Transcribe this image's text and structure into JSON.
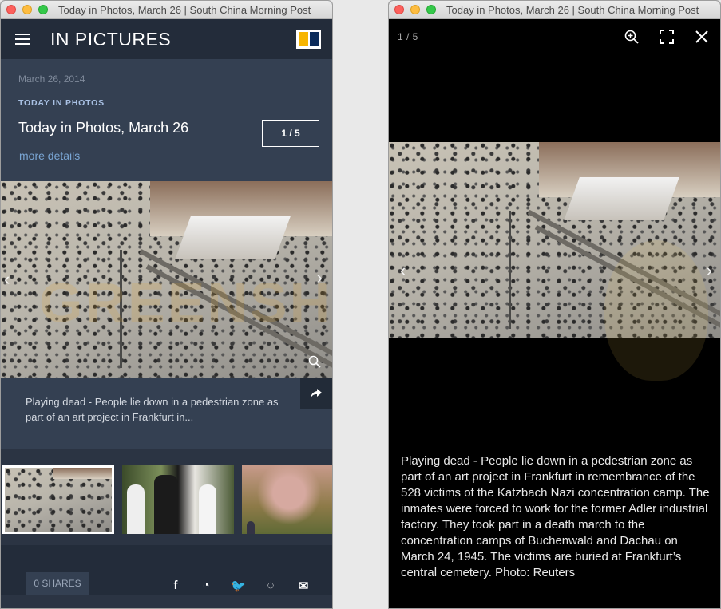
{
  "left_window": {
    "title": "Today in Photos, March 26 | South China Morning Post",
    "header": {
      "section": "IN PICTURES",
      "logo": "scmp-logo",
      "menu_icon": "hamburger-icon"
    },
    "article": {
      "date": "March 26, 2014",
      "kicker": "TODAY IN PHOTOS",
      "headline": "Today in Photos, March 26",
      "counter": "1 / 5",
      "more_label": "more details"
    },
    "photo": {
      "watermark": "GREENSHOT.FYI",
      "next_icon": "chevron-right-icon",
      "prev_icon": "chevron-left-icon",
      "zoom_icon": "search-icon"
    },
    "caption": "Playing dead - People lie down in a pedestrian zone as part of an art project in Frankfurt in...",
    "share_icon": "share-icon",
    "thumbnails": [
      {
        "name": "thumb-frankfurt",
        "selected": true
      },
      {
        "name": "thumb-tai-chi",
        "selected": false
      },
      {
        "name": "thumb-blossom",
        "selected": false
      }
    ],
    "footer": {
      "shares_label": "0 SHARES",
      "social": [
        {
          "icon": "facebook-icon",
          "glyph": "f"
        },
        {
          "icon": "messenger-icon",
          "glyph": "◔"
        },
        {
          "icon": "twitter-icon",
          "glyph": "🐦"
        },
        {
          "icon": "whatsapp-icon",
          "glyph": "◌"
        },
        {
          "icon": "email-icon",
          "glyph": "✉"
        }
      ]
    }
  },
  "right_window": {
    "title": "Today in Photos, March 26 | South China Morning Post",
    "counter": "1 / 5",
    "toolbar": {
      "zoom_icon": "zoom-in-icon",
      "fullscreen_icon": "fullscreen-icon",
      "close_icon": "close-icon"
    },
    "caption": "Playing dead - People lie down in a pedestrian zone as part of an art project in Frankfurt in remembrance of the 528 victims of the Katzbach Nazi concentration camp. The inmates were forced to work for the former Adler industrial factory. They took part in a death march to the concentration camps of Buchenwald and Dachau on March 24, 1945. The victims are buried at Frankfurt’s central cemetery. Photo: Reuters"
  }
}
